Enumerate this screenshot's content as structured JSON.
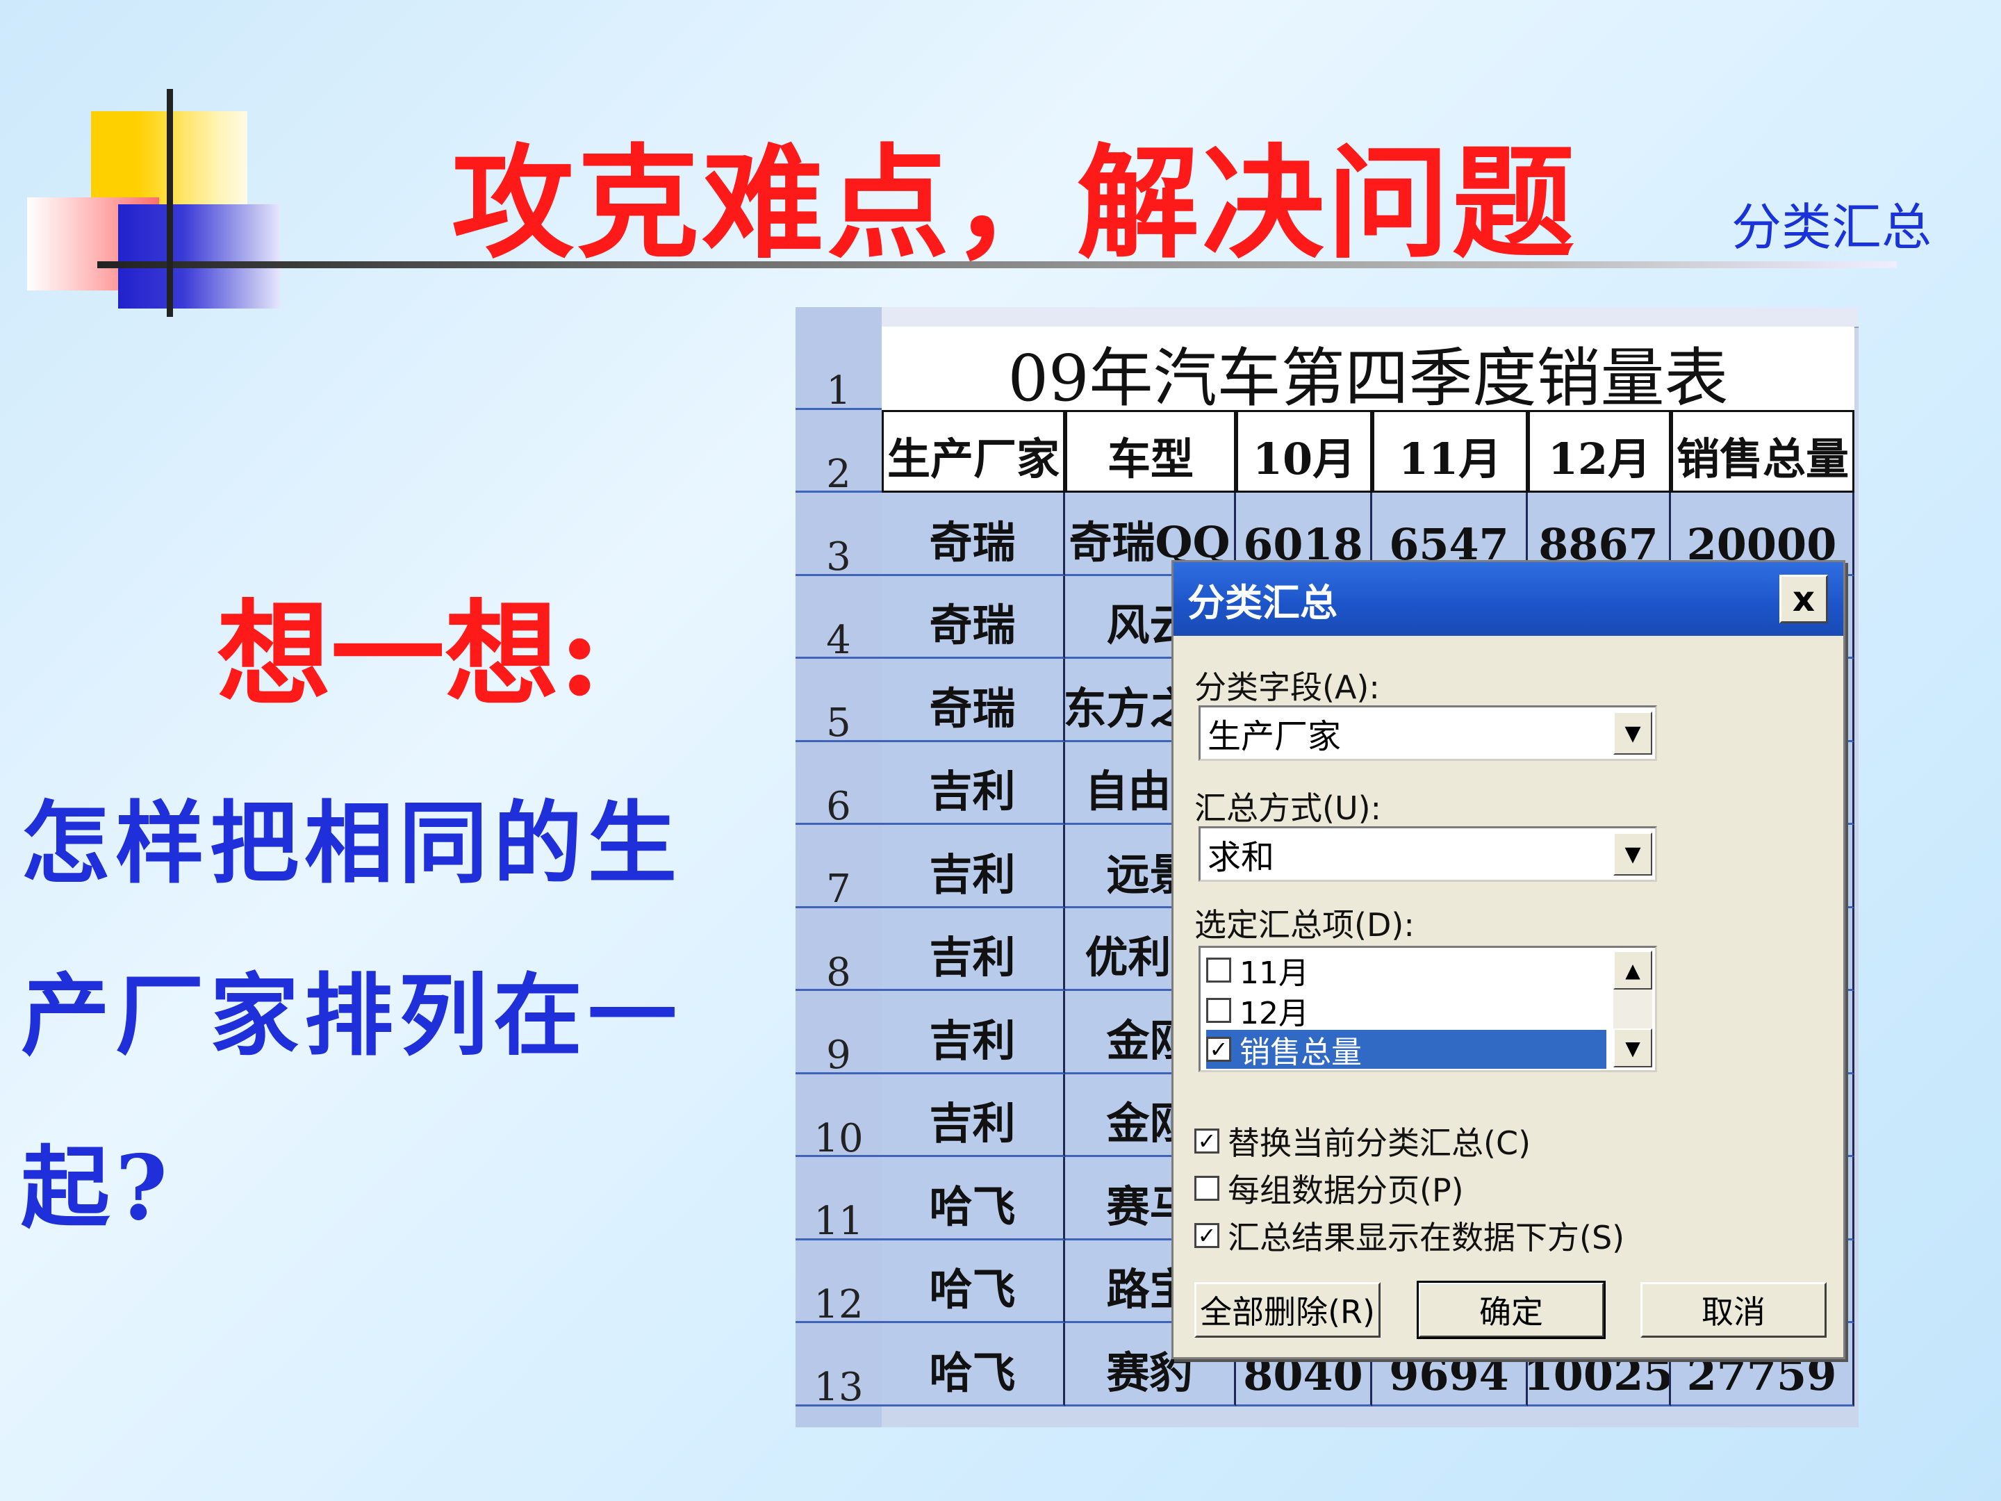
{
  "slide": {
    "title": "攻克难点，解决问题",
    "corner_label": "分类汇总",
    "think": "想一想:",
    "question_lines": [
      "怎样把相同的生",
      "产厂家排列在一",
      "起?"
    ]
  },
  "sheet": {
    "title": "09年汽车第四季度销量表",
    "row_numbers": [
      "1",
      "2",
      "3",
      "4",
      "5",
      "6",
      "7",
      "8",
      "9",
      "10",
      "11",
      "12",
      "13"
    ],
    "headers": [
      "生产厂家",
      "车型",
      "10月",
      "11月",
      "12月",
      "销售总量"
    ],
    "rows": [
      [
        "奇瑞",
        "奇瑞QQ",
        "",
        "",
        "",
        ""
      ],
      [
        "奇瑞",
        "风云",
        "",
        "",
        "",
        ""
      ],
      [
        "奇瑞",
        "东方之子",
        "",
        "",
        "",
        ""
      ],
      [
        "吉利",
        "自由舰",
        "",
        "",
        "",
        ""
      ],
      [
        "吉利",
        "远景",
        "",
        "",
        "",
        ""
      ],
      [
        "吉利",
        "优利欧",
        "",
        "",
        "",
        ""
      ],
      [
        "吉利",
        "金刚",
        "",
        "",
        "",
        ""
      ],
      [
        "吉利",
        "金刚",
        "",
        "",
        "",
        ""
      ],
      [
        "哈飞",
        "赛马",
        "",
        "",
        "",
        ""
      ],
      [
        "哈飞",
        "路宝",
        "",
        "",
        "",
        ""
      ],
      [
        "哈飞",
        "赛豹",
        "8040",
        "9694",
        "10025",
        "27759"
      ]
    ],
    "partial_row3": [
      "6018",
      "6547",
      "8867",
      "20000"
    ]
  },
  "dialog": {
    "title": "分类汇总",
    "close_label": "x",
    "group_field_label": "分类字段(A):",
    "group_field_value": "生产厂家",
    "func_label": "汇总方式(U):",
    "func_value": "求和",
    "items_label": "选定汇总项(D):",
    "items": [
      {
        "label": "11月",
        "checked": false,
        "selected": false
      },
      {
        "label": "12月",
        "checked": false,
        "selected": false
      },
      {
        "label": "销售总量",
        "checked": true,
        "selected": true
      }
    ],
    "options": [
      {
        "label": "替换当前分类汇总(C)",
        "checked": true
      },
      {
        "label": "每组数据分页(P)",
        "checked": false
      },
      {
        "label": "汇总结果显示在数据下方(S)",
        "checked": true
      }
    ],
    "buttons": {
      "remove_all": "全部删除(R)",
      "ok": "确定",
      "cancel": "取消"
    }
  }
}
